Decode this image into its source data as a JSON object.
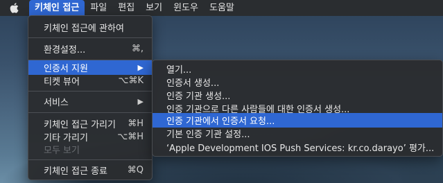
{
  "menubar": {
    "items": [
      "키체인 접근",
      "파일",
      "편집",
      "보기",
      "윈도우",
      "도움말"
    ]
  },
  "main_menu": {
    "about": "키체인 접근에 관하여",
    "preferences": "환경설정...",
    "preferences_shortcut": "⌘,",
    "cert_assistant": "인증서 지원",
    "ticket_viewer": "티켓 뷰어",
    "ticket_viewer_shortcut": "⌥⌘K",
    "services": "서비스",
    "hide": "키체인 접근 가리기",
    "hide_shortcut": "⌘H",
    "hide_others": "기타 가리기",
    "hide_others_shortcut": "⌥⌘H",
    "show_all": "모두 보기",
    "quit": "키체인 접근 종료",
    "quit_shortcut": "⌘Q"
  },
  "sub_menu": {
    "items": [
      "열기...",
      "인증서 생성...",
      "인증 기관 생성...",
      "인증 기관으로 다른 사람들에 대한 인증서 생성...",
      "인증 기관에서 인증서 요청...",
      "기본 인증 기관 설정...",
      "‘Apple Development IOS Push Services: kr.co.darayo’ 평가..."
    ]
  },
  "colors": {
    "highlight": "#2f67d2",
    "menu_bg": "#2a2c30"
  },
  "icons": {
    "apple": "apple-logo-icon",
    "submenu": "chevron-right-icon"
  }
}
